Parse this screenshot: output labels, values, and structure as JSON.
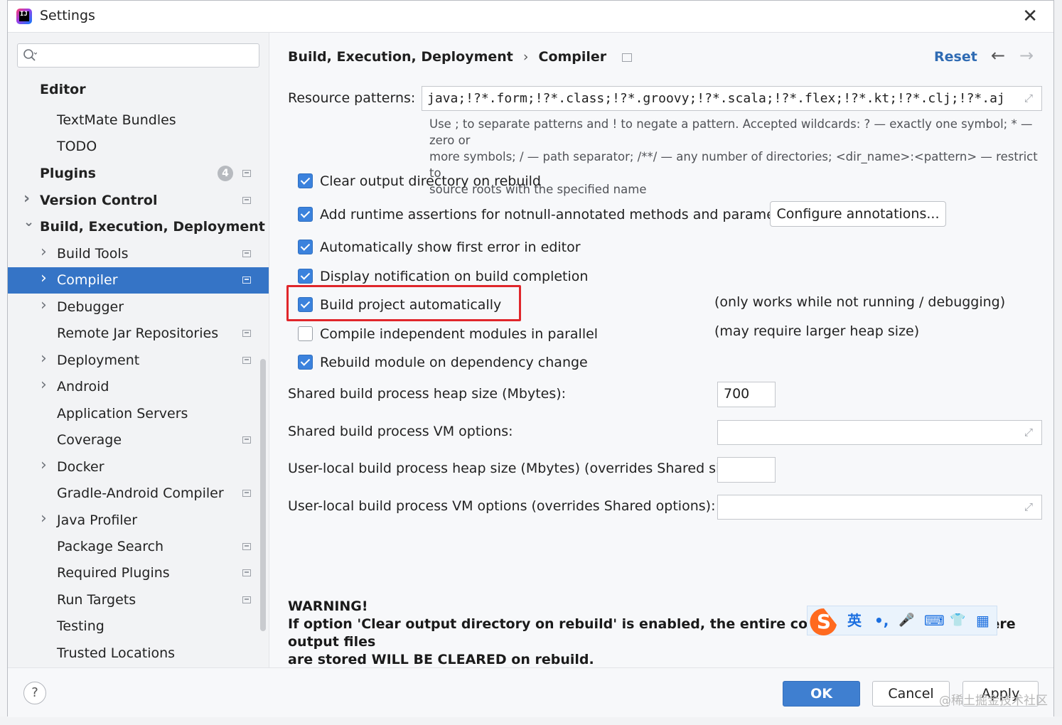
{
  "window": {
    "title": "Settings"
  },
  "sidebar": {
    "search_placeholder": "",
    "items": [
      {
        "label": "Editor",
        "bold": true,
        "level": 0,
        "chevron": ""
      },
      {
        "label": "TextMate Bundles",
        "bold": false,
        "level": 1,
        "chevron": ""
      },
      {
        "label": "TODO",
        "bold": false,
        "level": 1,
        "chevron": ""
      },
      {
        "label": "Plugins",
        "bold": true,
        "level": 0,
        "chevron": "",
        "badge": "4",
        "project_icon": true
      },
      {
        "label": "Version Control",
        "bold": true,
        "level": 0,
        "chevron": "right",
        "project_icon": true
      },
      {
        "label": "Build, Execution, Deployment",
        "bold": true,
        "level": 0,
        "chevron": "down"
      },
      {
        "label": "Build Tools",
        "bold": false,
        "level": 1,
        "chevron": "right",
        "project_icon": true
      },
      {
        "label": "Compiler",
        "bold": false,
        "level": 1,
        "chevron": "right",
        "project_icon": true,
        "selected": true
      },
      {
        "label": "Debugger",
        "bold": false,
        "level": 1,
        "chevron": "right"
      },
      {
        "label": "Remote Jar Repositories",
        "bold": false,
        "level": 1,
        "chevron": "",
        "project_icon": true
      },
      {
        "label": "Deployment",
        "bold": false,
        "level": 1,
        "chevron": "right",
        "project_icon": true
      },
      {
        "label": "Android",
        "bold": false,
        "level": 1,
        "chevron": "right"
      },
      {
        "label": "Application Servers",
        "bold": false,
        "level": 1,
        "chevron": ""
      },
      {
        "label": "Coverage",
        "bold": false,
        "level": 1,
        "chevron": "",
        "project_icon": true
      },
      {
        "label": "Docker",
        "bold": false,
        "level": 1,
        "chevron": "right"
      },
      {
        "label": "Gradle-Android Compiler",
        "bold": false,
        "level": 1,
        "chevron": "",
        "project_icon": true
      },
      {
        "label": "Java Profiler",
        "bold": false,
        "level": 1,
        "chevron": "right"
      },
      {
        "label": "Package Search",
        "bold": false,
        "level": 1,
        "chevron": "",
        "project_icon": true
      },
      {
        "label": "Required Plugins",
        "bold": false,
        "level": 1,
        "chevron": "",
        "project_icon": true
      },
      {
        "label": "Run Targets",
        "bold": false,
        "level": 1,
        "chevron": "",
        "project_icon": true
      },
      {
        "label": "Testing",
        "bold": false,
        "level": 1,
        "chevron": ""
      },
      {
        "label": "Trusted Locations",
        "bold": false,
        "level": 1,
        "chevron": ""
      }
    ]
  },
  "header": {
    "breadcrumb_parent": "Build, Execution, Deployment",
    "breadcrumb_separator": "›",
    "breadcrumb_current": "Compiler",
    "reset_label": "Reset",
    "back_arrow": "←",
    "forward_arrow": "→"
  },
  "compiler": {
    "resource_patterns_label": "Resource patterns:",
    "resource_patterns_value": "java;!?*.form;!?*.class;!?*.groovy;!?*.scala;!?*.flex;!?*.kt;!?*.clj;!?*.aj",
    "help_line1": "Use ; to separate patterns and ! to negate a pattern. Accepted wildcards: ? — exactly one symbol; * — zero or",
    "help_line2": "more symbols; / — path separator; /**/ — any number of directories; <dir_name>:<pattern> — restrict to",
    "help_line3": "source roots with the specified name",
    "checkboxes": [
      {
        "label": "Clear output directory on rebuild",
        "checked": true
      },
      {
        "label": "Add runtime assertions for notnull-annotated methods and parameters",
        "checked": true
      },
      {
        "label": "Automatically show first error in editor",
        "checked": true
      },
      {
        "label": "Display notification on build completion",
        "checked": true
      },
      {
        "label": "Build project automatically",
        "checked": true
      },
      {
        "label": "Compile independent modules in parallel",
        "checked": false
      },
      {
        "label": "Rebuild module on dependency change",
        "checked": true
      }
    ],
    "configure_annotations_label": "Configure annotations...",
    "note_build_auto": "(only works while not running / debugging)",
    "note_parallel": "(may require larger heap size)",
    "shared_heap_label": "Shared build process heap size (Mbytes):",
    "shared_heap_value": "700",
    "shared_vm_label": "Shared build process VM options:",
    "shared_vm_value": "",
    "user_heap_label": "User-local build process heap size (Mbytes) (overrides Shared size):",
    "user_heap_value": "",
    "user_vm_label": "User-local build process VM options (overrides Shared options):",
    "user_vm_value": "",
    "warning_title": "WARNING!",
    "warning_line1": "If option 'Clear output directory on rebuild' is enabled, the entire contents of directories where output files",
    "warning_line2": "are stored WILL BE CLEARED on rebuild."
  },
  "ime": {
    "lang": "英",
    "punct": "•,",
    "mic": "🎤",
    "keyboard": "⌨",
    "skin": "👕",
    "apps": "▦"
  },
  "footer": {
    "help_label": "?",
    "ok_label": "OK",
    "cancel_label": "Cancel",
    "apply_label": "Apply",
    "watermark": "@稀土掘金技术社区"
  },
  "colors": {
    "accent": "#3574c6",
    "highlight_border": "#e0262b",
    "link": "#2f6bb3"
  }
}
